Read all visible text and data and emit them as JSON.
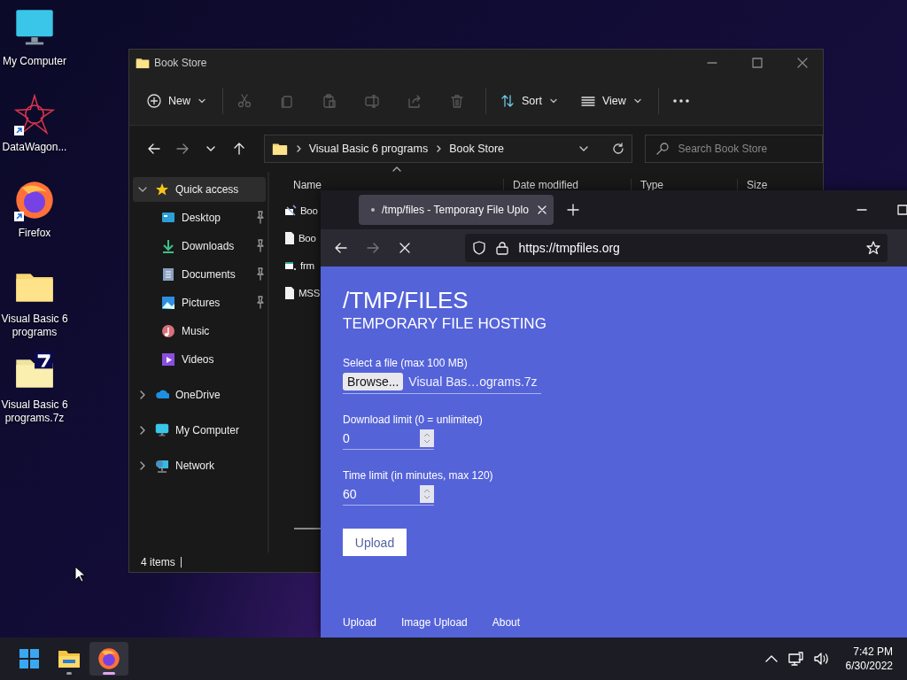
{
  "desktop": {
    "icons": [
      {
        "label": "My Computer",
        "kind": "monitor",
        "shortcut": false
      },
      {
        "label": "DataWagon...",
        "kind": "star",
        "shortcut": true
      },
      {
        "label": "Firefox",
        "kind": "browser",
        "shortcut": true
      },
      {
        "label": "Visual Basic 6 programs",
        "kind": "folder",
        "shortcut": false
      },
      {
        "label": "Visual Basic 6 programs.7z",
        "kind": "archive",
        "shortcut": false
      }
    ]
  },
  "explorer": {
    "title": "Book Store",
    "toolbar": [
      {
        "kind": "new",
        "label": "New",
        "disabled": false
      },
      {
        "kind": "cut",
        "disabled": true
      },
      {
        "kind": "copy",
        "disabled": true
      },
      {
        "kind": "paste",
        "disabled": true
      },
      {
        "kind": "rename",
        "disabled": true
      },
      {
        "kind": "share",
        "disabled": true
      },
      {
        "kind": "delete",
        "disabled": true
      },
      {
        "kind": "sort",
        "label": "Sort",
        "disabled": false
      },
      {
        "kind": "view",
        "label": "View",
        "disabled": false
      },
      {
        "kind": "more",
        "disabled": false
      }
    ],
    "nav": [
      {
        "kind": "back",
        "disabled": false
      },
      {
        "kind": "forward",
        "disabled": true
      },
      {
        "kind": "recent",
        "disabled": false
      },
      {
        "kind": "up",
        "disabled": false
      }
    ],
    "breadcrumb": [
      "Visual Basic 6 programs",
      "Book Store"
    ],
    "search": {
      "placeholder": "Search Book Store"
    },
    "sidebar": [
      {
        "label": "Quick access",
        "kind": "star",
        "expanded": true,
        "selected": true,
        "children": [
          {
            "label": "Desktop",
            "kind": "desktop",
            "pinned": true,
            "selected": false
          },
          {
            "label": "Downloads",
            "kind": "download",
            "pinned": true,
            "selected": false
          },
          {
            "label": "Documents",
            "kind": "document",
            "pinned": true,
            "selected": false
          },
          {
            "label": "Pictures",
            "kind": "picture",
            "pinned": true,
            "selected": false
          },
          {
            "label": "Music",
            "kind": "music",
            "pinned": false,
            "selected": false
          },
          {
            "label": "Videos",
            "kind": "video",
            "pinned": false,
            "selected": false
          }
        ]
      },
      {
        "label": "OneDrive",
        "kind": "cloud",
        "expanded": false,
        "selected": false
      },
      {
        "label": "My Computer",
        "kind": "monitor",
        "expanded": false,
        "selected": false
      },
      {
        "label": "Network",
        "kind": "network",
        "expanded": false,
        "selected": false
      }
    ],
    "columns": [
      "Name",
      "Date modified",
      "Type",
      "Size"
    ],
    "files": [
      {
        "name": "Boo",
        "kind": "setup"
      },
      {
        "name": "Boo",
        "kind": "file"
      },
      {
        "name": "frm",
        "kind": "form"
      },
      {
        "name": "MSS",
        "kind": "file"
      }
    ],
    "status": "4 items"
  },
  "browser": {
    "tab": {
      "title": "/tmp/files - Temporary File Uplo",
      "loading": true
    },
    "url": "https://tmpfiles.org",
    "page": {
      "heading": "/TMP/FILES",
      "subheading": "TEMPORARY FILE HOSTING",
      "fields": [
        {
          "kind": "file",
          "label": "Select a file (max 100 MB)",
          "button": "Browse...",
          "value": "Visual Bas…ograms.7z"
        },
        {
          "kind": "number",
          "label": "Download limit (0 = unlimited)",
          "value": "0"
        },
        {
          "kind": "number",
          "label": "Time limit (in minutes, max 120)",
          "value": "60"
        }
      ],
      "submit": "Upload",
      "links": [
        "Upload",
        "Image Upload",
        "About"
      ]
    }
  },
  "taskbar": {
    "apps": [
      {
        "kind": "start"
      },
      {
        "kind": "explorer",
        "running": true,
        "active": false
      },
      {
        "kind": "browser",
        "running": true,
        "active": true
      }
    ],
    "time": "7:42 PM",
    "date": "6/30/2022"
  }
}
